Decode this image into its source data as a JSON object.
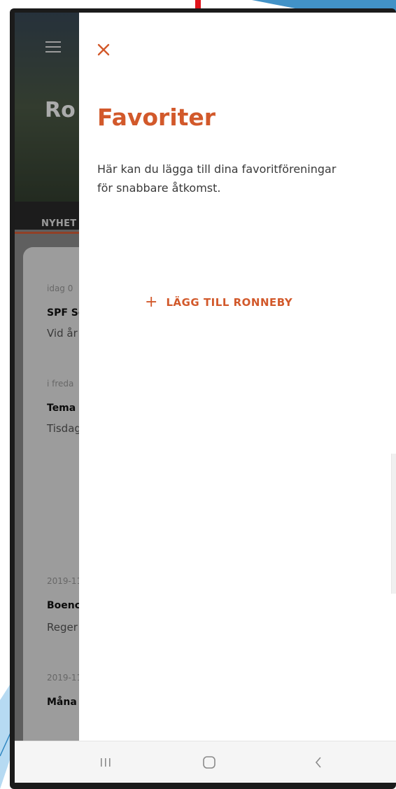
{
  "background_app": {
    "title": "Ro",
    "tab": "NYHET",
    "news": [
      {
        "date": "idag 0",
        "headline": "SPF Sc",
        "text": "Vid år"
      },
      {
        "date": "i freda",
        "headline": "Tema",
        "text": "Tisdag"
      },
      {
        "date": "2019-11",
        "headline": "Boenc",
        "text": "Reger"
      },
      {
        "date": "2019-11",
        "headline": "Måna",
        "text": ""
      }
    ]
  },
  "drawer": {
    "close_icon": "close-icon",
    "title": "Favoriter",
    "description": "Här kan du lägga till dina favoritföreningar för snabbare åtkomst.",
    "add_button": {
      "icon": "+",
      "label": "LÄGG TILL RONNEBY"
    }
  },
  "nav_bar": {
    "recents_icon": "recents-icon",
    "home_icon": "home-icon",
    "back_icon": "back-icon"
  },
  "colors": {
    "accent": "#d2592b",
    "arrow": "#e0141b",
    "drawer_bg": "#ffffff"
  }
}
